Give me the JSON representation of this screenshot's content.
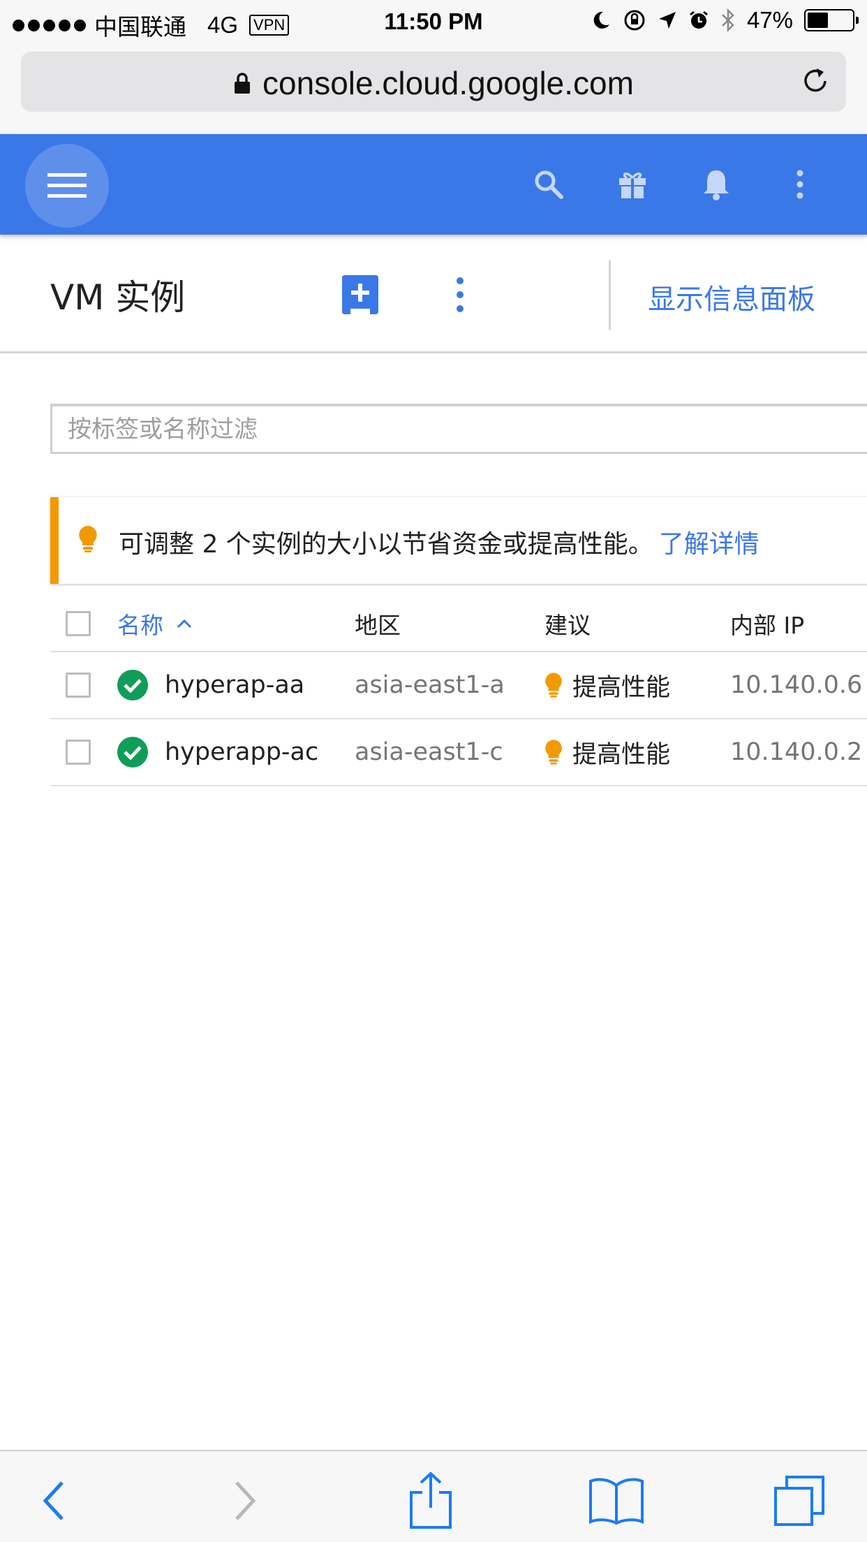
{
  "status_bar": {
    "carrier": "中国联通",
    "network": "4G",
    "vpn": "VPN",
    "time": "11:50 PM",
    "battery": "47%",
    "battery_level": 0.47
  },
  "browser": {
    "url": "console.cloud.google.com"
  },
  "app_bar": {
    "accent": "#3b78e7",
    "icons": [
      "menu-icon",
      "search-icon",
      "gift-icon",
      "bell-icon",
      "more-vert-icon"
    ]
  },
  "page": {
    "title": "VM 实例",
    "info_panel_link": "显示信息面板"
  },
  "filter": {
    "placeholder": "按标签或名称过滤"
  },
  "banner": {
    "text": "可调整 2 个实例的大小以节省资金或提高性能。",
    "link": "了解详情",
    "accent": "#f29900"
  },
  "table": {
    "headers": {
      "name": "名称",
      "zone": "地区",
      "recommendation": "建议",
      "internal_ip": "内部 IP"
    },
    "rows": [
      {
        "name": "hyperap-aa",
        "zone": "asia-east1-a",
        "recommendation": "提高性能",
        "internal_ip": "10.140.0.6"
      },
      {
        "name": "hyperapp-ac",
        "zone": "asia-east1-c",
        "recommendation": "提高性能",
        "internal_ip": "10.140.0.2"
      }
    ]
  }
}
